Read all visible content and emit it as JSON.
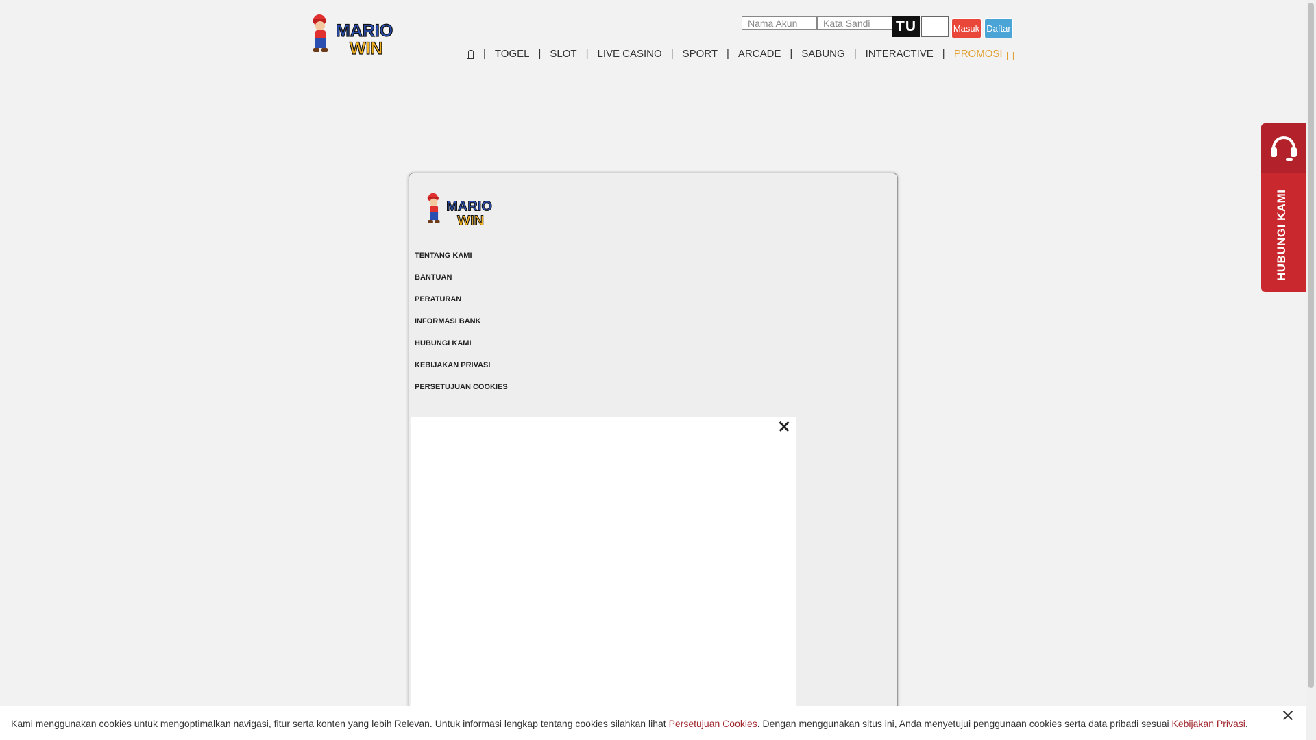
{
  "brand": {
    "logo_line1": "MARIO",
    "logo_line2": "WIN",
    "colors": {
      "red": "#e8473a",
      "blue": "#4aa5d6",
      "gold": "#f4b223",
      "dark_red": "#b3222a"
    }
  },
  "login": {
    "username_placeholder": "Nama Akun",
    "password_placeholder": "Kata Sandi",
    "captcha_text": "TU",
    "login_label": "Masuk",
    "register_label": "Daftar"
  },
  "nav": {
    "home_icon": "home-icon",
    "items": [
      "TOGEL",
      "SLOT",
      "LIVE CASINO",
      "SPORT",
      "ARCADE",
      "SABUNG",
      "INTERACTIVE"
    ],
    "promo_label": "PROMOSI",
    "promo_icon": "gift-icon"
  },
  "modal": {
    "menu": [
      "TENTANG KAMI",
      "BANTUAN",
      "PERATURAN",
      "INFORMASI BANK",
      "HUBUNGI KAMI",
      "KEBIJAKAN PRIVASI",
      "PERSETUJUAN COOKIES"
    ]
  },
  "contact_tab": {
    "label": "HUBUNGI KAMI",
    "icon": "headset-icon"
  },
  "cookie": {
    "text_before": "Kami menggunakan cookies untuk mengoptimalkan navigasi, fitur serta konten yang lebih Relevan. Untuk informasi lengkap tentang cookies silahkan lihat ",
    "link1": "Persetujuan Cookies",
    "text_middle": ". Dengan menggunakan situs ini, Anda menyetujui penggunaan cookies serta data pribadi sesuai ",
    "link2": "Kebijakan Privasi",
    "text_after": "."
  }
}
